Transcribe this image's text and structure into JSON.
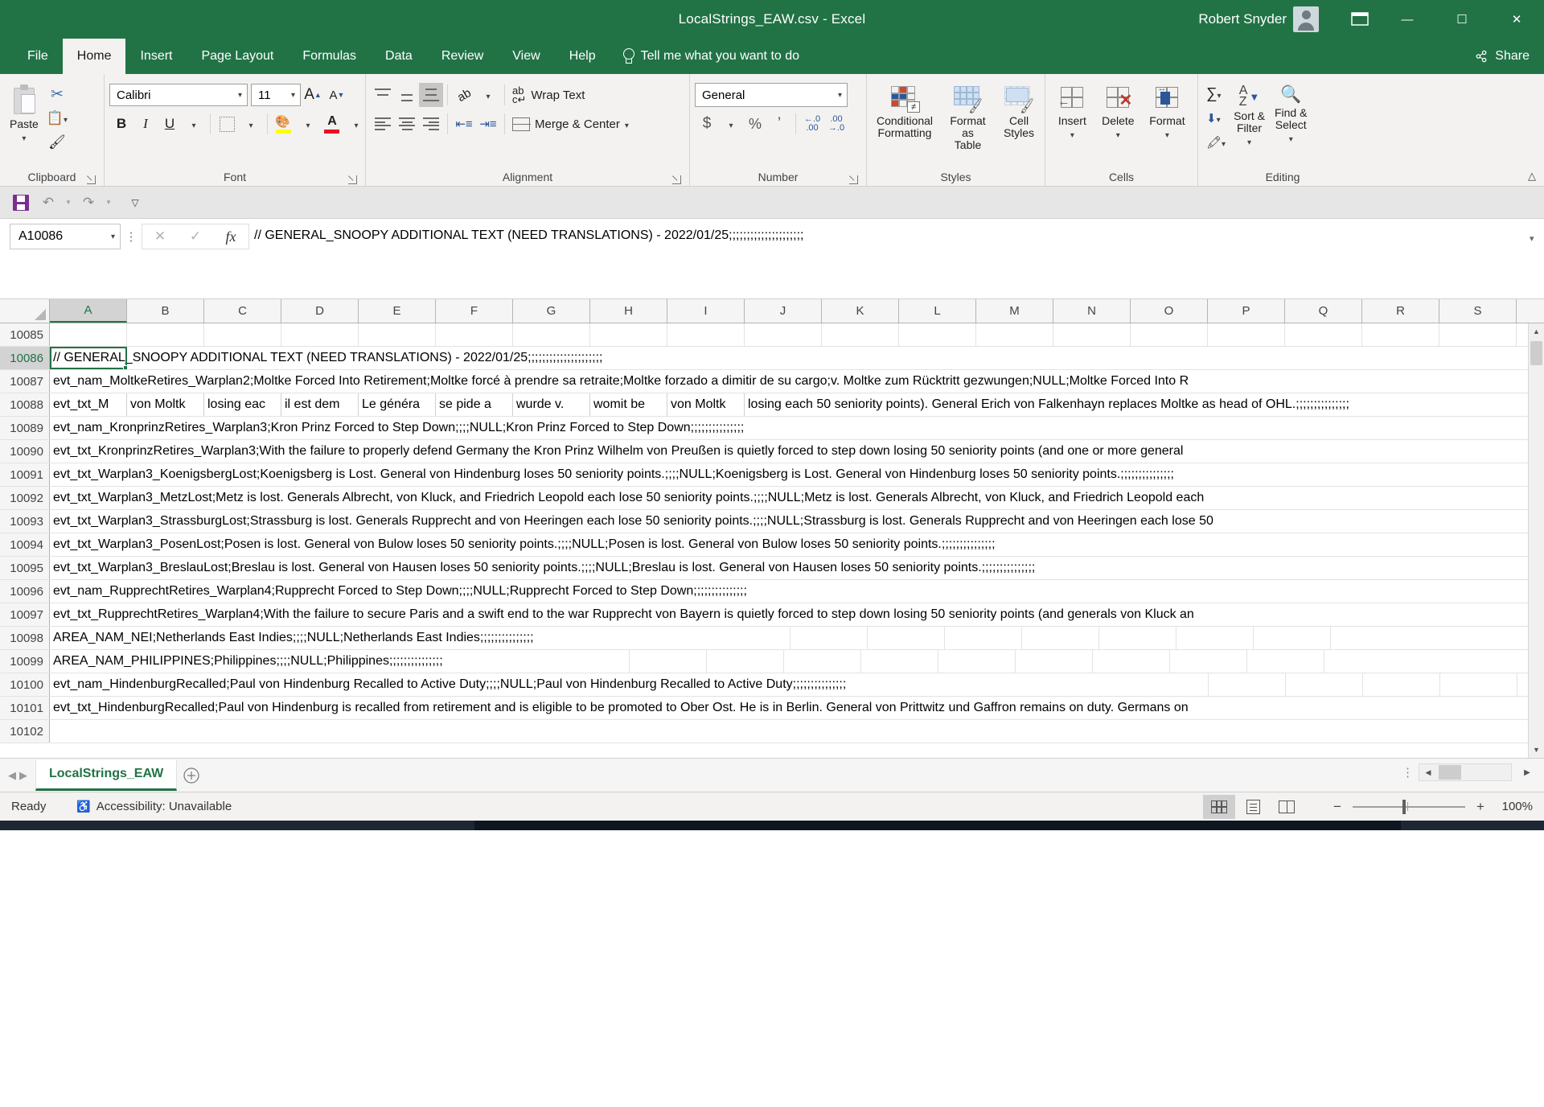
{
  "window": {
    "title": "LocalStrings_EAW.csv  -  Excel",
    "user": "Robert Snyder",
    "minimize": "—",
    "maximize": "☐",
    "close": "✕",
    "ribbon_display_options": "ribbon-display-options-icon"
  },
  "tabs": [
    {
      "label": "File",
      "active": false
    },
    {
      "label": "Home",
      "active": true
    },
    {
      "label": "Insert",
      "active": false
    },
    {
      "label": "Page Layout",
      "active": false
    },
    {
      "label": "Formulas",
      "active": false
    },
    {
      "label": "Data",
      "active": false
    },
    {
      "label": "Review",
      "active": false
    },
    {
      "label": "View",
      "active": false
    },
    {
      "label": "Help",
      "active": false
    }
  ],
  "tell_me": "Tell me what you want to do",
  "share": "Share",
  "ribbon": {
    "clipboard": {
      "label": "Clipboard",
      "paste": "Paste",
      "cut": "cut-icon",
      "copy": "copy-icon",
      "format_painter": "format-painter-icon"
    },
    "font": {
      "label": "Font",
      "font_name": "Calibri",
      "font_size": "11",
      "grow_font": "A",
      "shrink_font": "A",
      "bold": "B",
      "italic": "I",
      "underline": "U",
      "borders": "borders-icon",
      "fill_color": "fill-color-icon",
      "font_color": "A"
    },
    "alignment": {
      "label": "Alignment",
      "top_align": "top-align-icon",
      "middle_align": "middle-align-icon",
      "bottom_align": "bottom-align-icon",
      "orientation": "ab",
      "align_left": "align-left-icon",
      "align_center": "align-center-icon",
      "align_right": "align-right-icon",
      "decrease_indent": "decrease-indent-icon",
      "increase_indent": "increase-indent-icon",
      "wrap_text": "Wrap Text",
      "merge_center": "Merge & Center"
    },
    "number": {
      "label": "Number",
      "format": "General",
      "accounting": "$",
      "percent": "%",
      "comma": "’",
      "increase_decimal": "increase-decimal-icon",
      "decrease_decimal": "decrease-decimal-icon"
    },
    "styles": {
      "label": "Styles",
      "conditional_formatting": "Conditional Formatting",
      "conditional_formatting_l1": "Conditional",
      "conditional_formatting_l2": "Formatting",
      "format_as_table": "Format as Table",
      "format_as_table_l1": "Format as",
      "format_as_table_l2": "Table",
      "cell_styles": "Cell Styles",
      "cell_styles_l1": "Cell",
      "cell_styles_l2": "Styles"
    },
    "cells": {
      "label": "Cells",
      "insert": "Insert",
      "delete": "Delete",
      "format": "Format"
    },
    "editing": {
      "label": "Editing",
      "autosum": "∑",
      "fill": "fill-icon",
      "clear": "clear-icon",
      "sort_filter_l1": "Sort &",
      "sort_filter_l2": "Filter",
      "find_select_l1": "Find &",
      "find_select_l2": "Select"
    },
    "collapse": "collapse-ribbon-icon"
  },
  "quick_access": {
    "save": "save-icon",
    "undo": "undo-icon",
    "redo": "redo-icon",
    "customize": "customize-quick-access-toolbar-icon"
  },
  "formula_bar": {
    "name_box": "A10086",
    "cancel": "✕",
    "enter": "✓",
    "insert_function": "fx",
    "content": "// GENERAL_SNOOPY ADDITIONAL TEXT (NEED TRANSLATIONS) - 2022/01/25;;;;;;;;;;;;;;;;;;;;;"
  },
  "grid": {
    "columns": [
      "A",
      "B",
      "C",
      "D",
      "E",
      "F",
      "G",
      "H",
      "I",
      "J",
      "K",
      "L",
      "M",
      "N",
      "O",
      "P",
      "Q",
      "R",
      "S"
    ],
    "selected_column": "A",
    "selected_row": "10086",
    "rows": [
      {
        "num": "10085",
        "text": "",
        "split": null
      },
      {
        "num": "10086",
        "text": "// GENERAL_SNOOPY ADDITIONAL TEXT (NEED TRANSLATIONS) - 2022/01/25;;;;;;;;;;;;;;;;;;;;;",
        "split": null
      },
      {
        "num": "10087",
        "text": "evt_nam_MoltkeRetires_Warplan2;Moltke Forced Into Retirement;Moltke forcé à prendre sa retraite;Moltke forzado a dimitir de su cargo;v. Moltke zum Rücktritt gezwungen;NULL;Moltke Forced Into R",
        "split": null
      },
      {
        "num": "10088",
        "text": "",
        "split": [
          "evt_txt_M",
          "von Moltk",
          "losing eac",
          "il est dem",
          "Le généra",
          "se pide a",
          "wurde v.",
          "womit be",
          "von Moltk",
          "losing each 50 seniority points). General Erich von Falkenhayn replaces Moltke as head of OHL.;;;;;;;;;;;;;;;"
        ]
      },
      {
        "num": "10089",
        "text": "evt_nam_KronprinzRetires_Warplan3;Kron Prinz Forced to Step Down;;;;NULL;Kron Prinz Forced to Step Down;;;;;;;;;;;;;;;",
        "split": null
      },
      {
        "num": "10090",
        "text": "evt_txt_KronprinzRetires_Warplan3;With the failure to properly defend Germany the Kron Prinz Wilhelm von Preußen is quietly forced to step down losing 50 seniority points (and one or more general",
        "split": null
      },
      {
        "num": "10091",
        "text": "evt_txt_Warplan3_KoenigsbergLost;Koenigsberg is Lost. General von Hindenburg loses 50 seniority points.;;;;NULL;Koenigsberg is Lost. General von Hindenburg loses 50 seniority points.;;;;;;;;;;;;;;;",
        "split": null
      },
      {
        "num": "10092",
        "text": "evt_txt_Warplan3_MetzLost;Metz is lost. Generals Albrecht, von Kluck, and Friedrich Leopold each lose 50 seniority points.;;;;NULL;Metz is lost. Generals Albrecht, von Kluck, and Friedrich Leopold each",
        "split": null
      },
      {
        "num": "10093",
        "text": "evt_txt_Warplan3_StrassburgLost;Strassburg is lost. Generals Rupprecht and von Heeringen each lose 50 seniority points.;;;;NULL;Strassburg is lost. Generals Rupprecht and von Heeringen each lose 50",
        "split": null
      },
      {
        "num": "10094",
        "text": "evt_txt_Warplan3_PosenLost;Posen is lost. General von Bulow loses 50 seniority points.;;;;NULL;Posen is lost. General von Bulow loses 50 seniority points.;;;;;;;;;;;;;;;",
        "split": null
      },
      {
        "num": "10095",
        "text": "evt_txt_Warplan3_BreslauLost;Breslau is lost. General von Hausen loses 50 seniority points.;;;;NULL;Breslau is lost. General von Hausen loses 50 seniority points.;;;;;;;;;;;;;;;",
        "split": null
      },
      {
        "num": "10096",
        "text": "evt_nam_RupprechtRetires_Warplan4;Rupprecht Forced to Step Down;;;;NULL;Rupprecht Forced to Step Down;;;;;;;;;;;;;;;",
        "split": null
      },
      {
        "num": "10097",
        "text": "evt_txt_RupprechtRetires_Warplan4;With the failure to secure Paris and a swift end to the war Rupprecht von Bayern is quietly forced to step down losing 50 seniority points (and generals von Kluck an",
        "split": null
      },
      {
        "num": "10098",
        "text": "AREA_NAM_NEI;Netherlands East Indies;;;;NULL;Netherlands East Indies;;;;;;;;;;;;;;;",
        "split": null
      },
      {
        "num": "10099",
        "text": "AREA_NAM_PHILIPPINES;Philippines;;;;NULL;Philippines;;;;;;;;;;;;;;;",
        "split": null
      },
      {
        "num": "10100",
        "text": "evt_nam_HindenburgRecalled;Paul von Hindenburg Recalled to Active Duty;;;;NULL;Paul von Hindenburg Recalled to Active Duty;;;;;;;;;;;;;;;",
        "split": null
      },
      {
        "num": "10101",
        "text": "evt_txt_HindenburgRecalled;Paul von Hindenburg is recalled from retirement and is eligible to be promoted to Ober Ost. He is in Berlin. General von Prittwitz und Gaffron remains on duty. Germans on",
        "split": null
      },
      {
        "num": "10102",
        "text": "",
        "split": null
      }
    ]
  },
  "sheet_bar": {
    "prev": "◀",
    "next": "▶",
    "sheets": [
      {
        "name": "LocalStrings_EAW",
        "active": true
      }
    ],
    "add_sheet": "+"
  },
  "status_bar": {
    "mode": "Ready",
    "accessibility": "Accessibility: Unavailable",
    "views": [
      {
        "name": "normal-view",
        "active": true
      },
      {
        "name": "page-layout-view",
        "active": false
      },
      {
        "name": "page-break-preview",
        "active": false
      }
    ],
    "zoom_out": "−",
    "zoom_in": "+",
    "zoom_level": "100%"
  },
  "colors": {
    "excel_green": "#217346",
    "ribbon_bg": "#f3f2f1",
    "selection_green": "#217346",
    "accent_blue": "#2b579a"
  }
}
